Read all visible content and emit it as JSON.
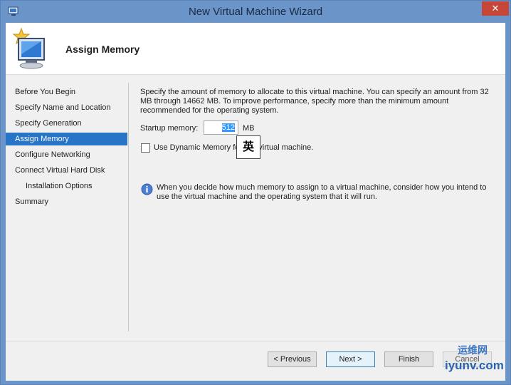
{
  "window": {
    "title": "New Virtual Machine Wizard",
    "close_symbol": "✕"
  },
  "header": {
    "title": "Assign Memory"
  },
  "nav": {
    "items": [
      {
        "label": "Before You Begin"
      },
      {
        "label": "Specify Name and Location"
      },
      {
        "label": "Specify Generation"
      },
      {
        "label": "Assign Memory"
      },
      {
        "label": "Configure Networking"
      },
      {
        "label": "Connect Virtual Hard Disk"
      },
      {
        "label": "Installation Options"
      },
      {
        "label": "Summary"
      }
    ],
    "active_index": 3
  },
  "main": {
    "description": "Specify the amount of memory to allocate to this virtual machine. You can specify an amount from 32 MB through 14662 MB. To improve performance, specify more than the minimum amount recommended for the operating system.",
    "startup_memory_label": "Startup memory:",
    "startup_memory_value": "512",
    "startup_memory_unit": "MB",
    "dynamic_memory_label": "Use Dynamic Memory for this virtual machine.",
    "dynamic_memory_checked": false,
    "ime_indicator": "英",
    "info_text": "When you decide how much memory to assign to a virtual machine, consider how you intend to use the virtual machine and the operating system that it will run."
  },
  "footer": {
    "previous_label": "< Previous",
    "next_label": "Next >",
    "finish_label": "Finish",
    "cancel_label": "Cancel"
  },
  "watermark": {
    "line1": "运维网",
    "line2": "iyunv.com"
  },
  "colors": {
    "titlebar": "#6b94c8",
    "active_nav": "#2875c8",
    "close_button": "#c7463a"
  }
}
